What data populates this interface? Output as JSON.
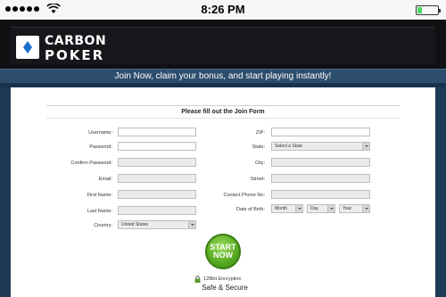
{
  "status_bar": {
    "time": "8:26 PM"
  },
  "brand": {
    "line1": "CARBON",
    "line2": "POKER"
  },
  "tagline": "Join Now, claim your bonus, and start playing instantly!",
  "form": {
    "heading": "Please fill out the Join Form",
    "left_fields": [
      {
        "label": "Username:"
      },
      {
        "label": "Password:"
      },
      {
        "label": "Confirm Password:"
      },
      {
        "label": "Email:"
      },
      {
        "label": "First Name:"
      },
      {
        "label": "Last Name:"
      },
      {
        "label": "Country:",
        "value": "United States"
      }
    ],
    "right_fields": [
      {
        "label": "ZIP:"
      },
      {
        "label": "State:",
        "value": "Select a State"
      },
      {
        "label": "City:"
      },
      {
        "label": "Street:"
      },
      {
        "label": "Contact Phone No:"
      }
    ],
    "dob": {
      "label": "Date of Birth:",
      "month": "Month",
      "day": "Day",
      "year": "Year"
    },
    "start_button": {
      "line1": "START",
      "line2": "NOW"
    },
    "encryption_text": "128bit Encryption",
    "safe_text": "Safe & Secure"
  },
  "colors": {
    "header_bg": "#0f1113",
    "tagline_bg": "#2d4d6c",
    "start_green": "#55a81f"
  }
}
